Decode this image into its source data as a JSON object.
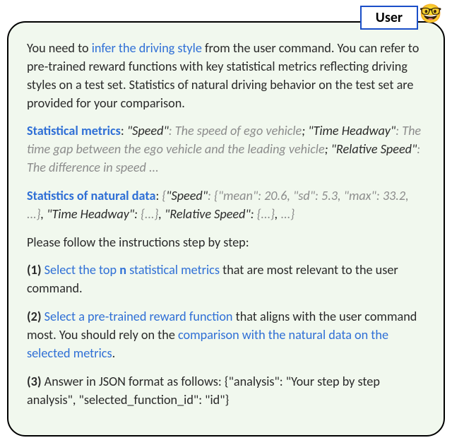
{
  "header": {
    "user_label": "User",
    "emoji": "🤓"
  },
  "p1": {
    "a": "You need to ",
    "b": "infer the driving style",
    "c": " from the user command. You can refer to pre-trained reward functions with key statistical metrics reflecting driving styles on a test set. Statistics of natural driving behavior on the test set are provided for your comparison."
  },
  "p2": {
    "label": "Statistical metrics",
    "colon": ": ",
    "speed_q": "\"Speed\"",
    "sep0": ": ",
    "speed_desc": "The speed of ego vehicle",
    "sep1": "; ",
    "th_q": "\"Time Headway\"",
    "sep2": ": ",
    "th_desc": "The time gap between the ego vehicle and the leading vehicle",
    "sep3": "; ",
    "rs_q": "\"Relative Speed\"",
    "sep4": ": ",
    "rs_desc": "The difference in speed ..."
  },
  "p3": {
    "label": "Statistics of natural data",
    "colon": ": ",
    "open": "{",
    "speed_q": "\"Speed\"",
    "speed_sep": ": ",
    "speed_obj": "{\"mean\": 20.6, \"sd\": 5.3, \"max\": 33.2, ...}",
    "comma1": ", ",
    "th_q": "\"Time Headway\"",
    "th_sep": ": ",
    "th_obj": "{...}",
    "comma2": ", ",
    "rs_q": "\"Relative Speed\"",
    "rs_sep": ": ",
    "rs_obj": "{...}",
    "comma3": ", ",
    "tail": "...}"
  },
  "p4": {
    "text": "Please follow the instructions step by step:"
  },
  "s1": {
    "num": "(1) ",
    "blue_a": "Select the top ",
    "blue_n": "n",
    "blue_b": " statistical metrics",
    "black": " that are most relevant to the user command."
  },
  "s2": {
    "num": "(2) ",
    "blue_a": "Select a pre-trained reward function",
    "black_a": " that aligns with the user command most. You should rely on the ",
    "blue_b": "comparison with the natural data on the selected metrics",
    "black_b": "."
  },
  "s3": {
    "num": "(3) ",
    "text_a": "Answer in JSON format as follows: {\"analysis\": \"Your step by step analysis\", \"selected_function_id\": \"id\"}"
  }
}
